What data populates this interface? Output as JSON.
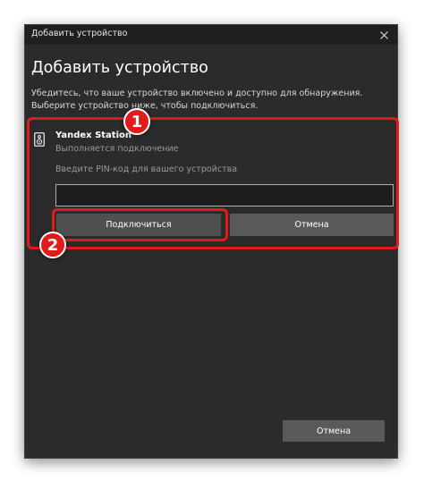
{
  "window": {
    "title": "Добавить устройство",
    "heading": "Добавить устройство",
    "description_line1": "Убедитесь, что ваше устройство включено и доступно для обнаружения.",
    "description_line2": "Выберите устройство ниже, чтобы подключиться."
  },
  "device": {
    "name": "Yandex Station",
    "status": "Выполняется подключение",
    "icon": "speaker-icon"
  },
  "pin": {
    "label": "Введите PIN-код для вашего устройства",
    "value": ""
  },
  "buttons": {
    "connect": "Подключиться",
    "cancel_inner": "Отмена",
    "cancel_bottom": "Отмена"
  },
  "annotations": {
    "badge_1": "1",
    "badge_2": "2",
    "highlight_color": "#e21a1a"
  },
  "colors": {
    "window_bg": "#2b2b2b",
    "titlebar_bg": "#1f1f1f",
    "button_bg": "#5a5a5a",
    "accent": "#e21a1a"
  }
}
